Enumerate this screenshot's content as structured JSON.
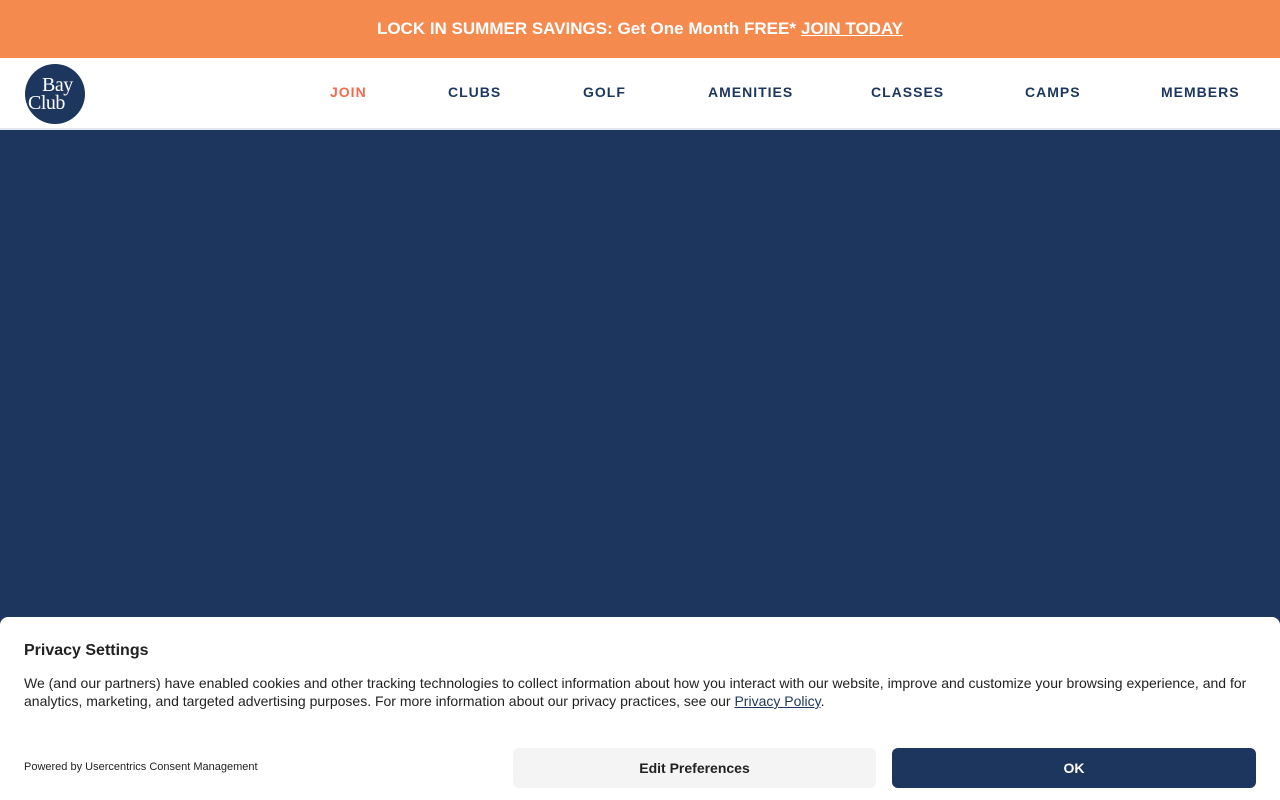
{
  "promo": {
    "text": "LOCK IN SUMMER SAVINGS: Get One Month FREE*",
    "link": "JOIN TODAY"
  },
  "logo": {
    "line1": "Bay",
    "line2": "Club"
  },
  "nav": {
    "items": [
      {
        "label": "JOIN",
        "active": true
      },
      {
        "label": "CLUBS"
      },
      {
        "label": "GOLF"
      },
      {
        "label": "AMENITIES"
      },
      {
        "label": "CLASSES"
      },
      {
        "label": "CAMPS"
      },
      {
        "label": "MEMBERS"
      }
    ]
  },
  "consent": {
    "title": "Privacy Settings",
    "body": "We (and our partners) have enabled cookies and other tracking technologies to collect information about how you interact with our website, improve and customize your browsing experience, and for analytics, marketing, and targeted advertising purposes. For more information about our privacy practices, see our",
    "link": "Privacy Policy",
    "period": ".",
    "powered_by": "Powered by Usercentrics Consent Management",
    "edit_button": "Edit Preferences",
    "ok_button": "OK"
  },
  "colors": {
    "promo_bg": "#f58a4f",
    "brand_navy": "#1c365e",
    "nav_active": "#f06b4f"
  }
}
